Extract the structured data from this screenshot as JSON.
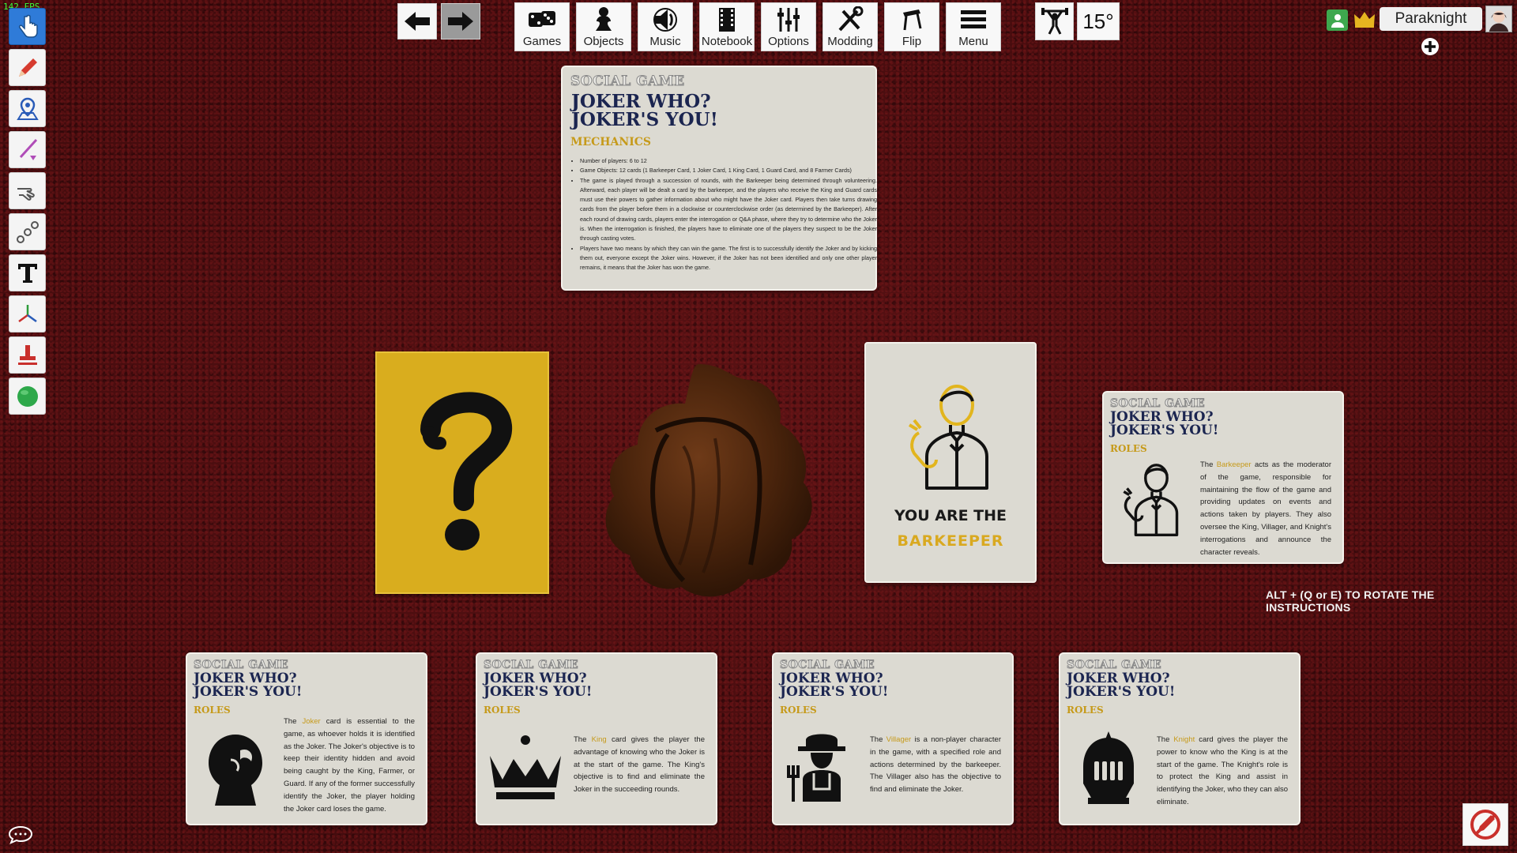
{
  "fps": "142 FPS",
  "nav": {
    "buttons": [
      {
        "id": "games",
        "label": "Games"
      },
      {
        "id": "objects",
        "label": "Objects"
      },
      {
        "id": "music",
        "label": "Music"
      },
      {
        "id": "notebook",
        "label": "Notebook"
      },
      {
        "id": "options",
        "label": "Options"
      },
      {
        "id": "modding",
        "label": "Modding"
      },
      {
        "id": "flip",
        "label": "Flip"
      },
      {
        "id": "menu",
        "label": "Menu"
      }
    ],
    "rotation": "15°"
  },
  "user": {
    "name": "Paraknight"
  },
  "tools": [
    "pointer-icon",
    "pen-icon",
    "location-pin-icon",
    "line-tool-icon",
    "flick-icon",
    "joint-icon",
    "text-icon",
    "gizmo-icon",
    "stamp-icon",
    "ball-icon"
  ],
  "instructions_card": {
    "tag": "SOCIAL GAME",
    "title_line1": "JOKER WHO?",
    "title_line2": "JOKER'S YOU!",
    "section": "MECHANICS",
    "bullets": [
      "Number of players: 6 to 12",
      "Game Objects: 12 cards (1 Barkeeper Card, 1 Joker Card, 1 King Card, 1 Guard Card, and 8 Farmer Cards)",
      "The game is played through a succession of rounds, with the Barkeeper being determined through volunteering. Afterward, each player will be dealt a card by the barkeeper, and the players who receive the King and Guard cards must use their powers to gather information about who might have the Joker card. Players then take turns drawing cards from the player before them in a clockwise or counterclockwise order (as determined by the Barkeeper). After each round of drawing cards, players enter the interrogation or Q&A phase, where they try to determine who the Joker is. When the interrogation is finished, the players have to eliminate one of the players they suspect to be the Joker through casting votes.",
      "Players have two means by which they can win the game. The first is to successfully identify the Joker and by kicking them out, everyone except the Joker wins. However, if the Joker has not been identified and only one other player remains, it means that the Joker has won the game."
    ]
  },
  "barkeeper_card": {
    "line1": "YOU ARE THE",
    "line2": "BARKEEPER"
  },
  "instructions_hint": "ALT + (Q or E) TO ROTATE THE INSTRUCTIONS",
  "role_cards": [
    {
      "tag": "SOCIAL GAME",
      "title_line1": "JOKER WHO?",
      "title_line2": "JOKER'S YOU!",
      "section": "ROLES",
      "icon": "barkeeper-icon",
      "pre": "The ",
      "role": "Barkeeper",
      "post": " acts as the moderator of the game, responsible for maintaining the flow of the game and providing updates on events and actions taken by players. They also oversee the King, Villager, and Knight's interrogations and announce the character reveals."
    },
    {
      "tag": "SOCIAL GAME",
      "title_line1": "JOKER WHO?",
      "title_line2": "JOKER'S YOU!",
      "section": "ROLES",
      "icon": "joker-icon",
      "pre": "The ",
      "role": "Joker",
      "post": " card is essential to the game, as whoever holds it is identified as the Joker. The Joker's objective is to keep their identity hidden and avoid being caught by the King, Farmer, or Guard. If any of the former successfully identify the Joker, the player holding the Joker card loses the game."
    },
    {
      "tag": "SOCIAL GAME",
      "title_line1": "JOKER WHO?",
      "title_line2": "JOKER'S YOU!",
      "section": "ROLES",
      "icon": "crown-icon",
      "pre": "The ",
      "role": "King",
      "post": " card gives the player the advantage of knowing who the Joker is at the start of the game. The King's objective is to find and eliminate the Joker in the succeeding rounds."
    },
    {
      "tag": "SOCIAL GAME",
      "title_line1": "JOKER WHO?",
      "title_line2": "JOKER'S YOU!",
      "section": "ROLES",
      "icon": "farmer-icon",
      "pre": "The ",
      "role": "Villager",
      "post": " is a non-player character in the game, with a specified role and actions determined by the barkeeper. The Villager also has the objective to find and eliminate the Joker."
    },
    {
      "tag": "SOCIAL GAME",
      "title_line1": "JOKER WHO?",
      "title_line2": "JOKER'S YOU!",
      "section": "ROLES",
      "icon": "knight-helmet-icon",
      "pre": "The ",
      "role": "Knight",
      "post": " card gives the player the power to know who the King is at the start of the game. The Knight's role is to protect the King and assist in identifying the Joker, who they can also eliminate."
    }
  ]
}
